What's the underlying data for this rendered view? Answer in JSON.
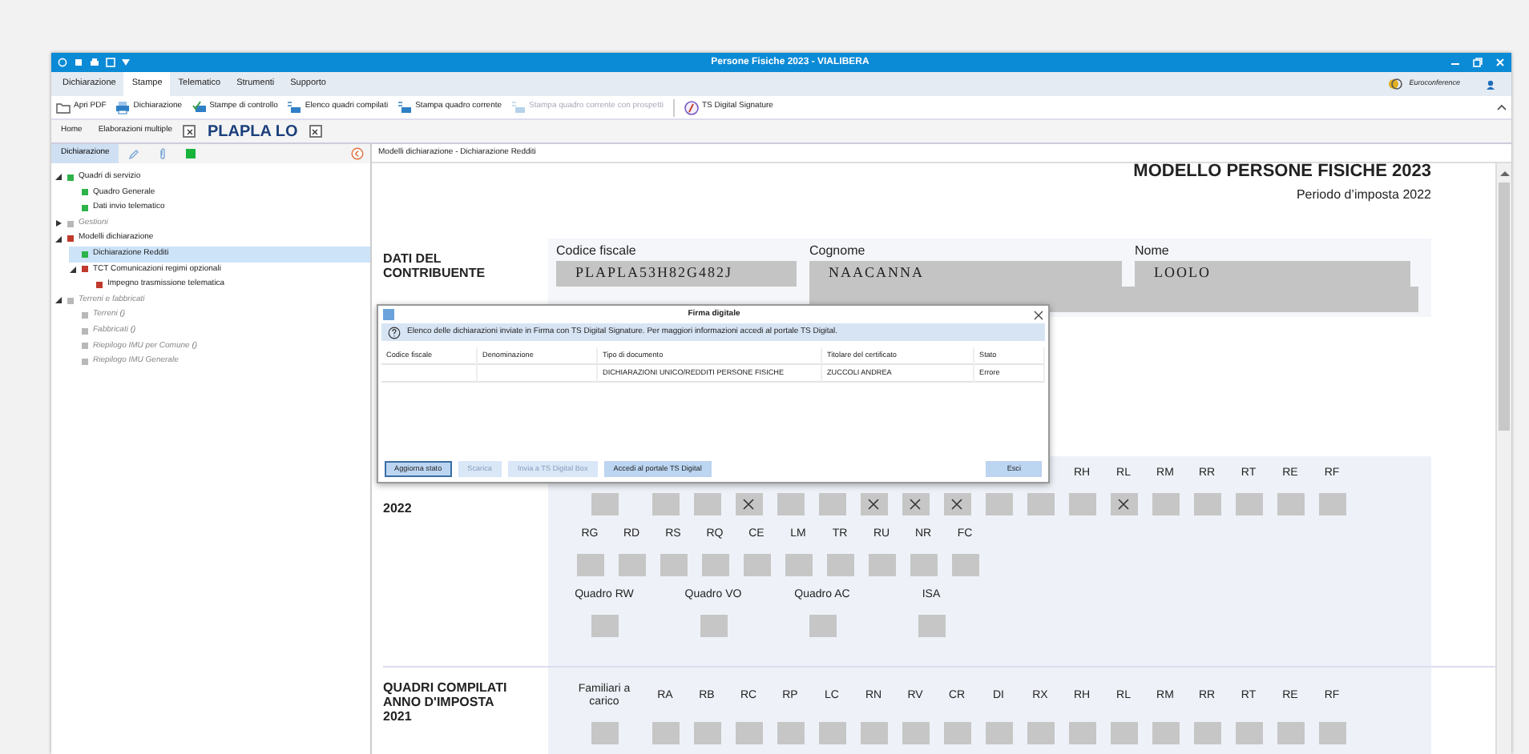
{
  "window": {
    "title": "Persone Fisiche 2023 - VIALIBERA"
  },
  "menu": [
    {
      "label": "Dichiarazione",
      "selected": false
    },
    {
      "label": "Stampe",
      "selected": true
    },
    {
      "label": "Telematico",
      "selected": false
    },
    {
      "label": "Strumenti",
      "selected": false
    },
    {
      "label": "Supporto",
      "selected": false
    }
  ],
  "brand": {
    "name": "Euroconference"
  },
  "toolbar": [
    {
      "kind": "folder",
      "label": "Apri PDF",
      "disabled": false
    },
    {
      "kind": "printer",
      "label": "Dichiarazione",
      "disabled": false
    },
    {
      "kind": "check",
      "label": "Stampe di controllo",
      "disabled": false
    },
    {
      "kind": "list",
      "label": "Elenco quadri compilati",
      "disabled": false
    },
    {
      "kind": "list",
      "label": "Stampa quadro corrente",
      "disabled": false
    },
    {
      "kind": "list",
      "label": "Stampa quadro corrente con prospetti",
      "disabled": true
    },
    {
      "kind": "signature",
      "label": "TS Digital Signature",
      "disabled": false
    }
  ],
  "tabs": [
    {
      "label": "Home",
      "closable": false,
      "selected": false
    },
    {
      "label": "Elaborazioni multiple",
      "closable": true,
      "selected": false
    },
    {
      "label": "PLAPLA LO",
      "closable": true,
      "selected": true
    }
  ],
  "panel_tabs": [
    {
      "kind": "text",
      "label": "Dichiarazione",
      "selected": true
    },
    {
      "kind": "pencil",
      "selected": false
    },
    {
      "kind": "clip",
      "selected": false
    },
    {
      "kind": "status",
      "selected": false
    }
  ],
  "breadcrumb": "Modelli dichiarazione - Dichiarazione Redditi",
  "tree": [
    {
      "label": "Quadri di servizio",
      "color": "#2db34a",
      "empty": false,
      "expanded": true,
      "children": [
        {
          "label": "Quadro Generale",
          "color": "#2db34a",
          "empty": false,
          "selected": false
        },
        {
          "label": "Dati invio telematico",
          "color": "#2db34a",
          "empty": false,
          "selected": false
        }
      ],
      "selected": false
    },
    {
      "label": "Gestioni",
      "color": "#b8b8b8",
      "empty": true,
      "expanded": false,
      "selected": false
    },
    {
      "label": "Modelli dichiarazione",
      "color": "#c0392b",
      "empty": false,
      "expanded": true,
      "selected": false,
      "children": [
        {
          "label": "Dichiarazione Redditi",
          "color": "#2db34a",
          "empty": false,
          "selected": true
        },
        {
          "label": "TCT Comunicazioni regimi opzionali",
          "color": "#c0392b",
          "empty": false,
          "expanded": true,
          "selected": false,
          "children": [
            {
              "label": "Impegno trasmissione telematica",
              "color": "#c0392b",
              "empty": false,
              "selected": false
            }
          ]
        }
      ]
    },
    {
      "label": "Terreni e fabbricati",
      "color": "#b8b8b8",
      "empty": true,
      "expanded": true,
      "selected": false,
      "children": [
        {
          "label": "Terreni ()",
          "color": "#b8b8b8",
          "empty": true,
          "selected": false
        },
        {
          "label": "Fabbricati ()",
          "color": "#b8b8b8",
          "empty": true,
          "selected": false
        },
        {
          "label": "Riepilogo IMU per Comune ()",
          "color": "#b8b8b8",
          "empty": true,
          "selected": false
        },
        {
          "label": "Riepilogo IMU Generale",
          "color": "#b8b8b8",
          "empty": true,
          "selected": false
        }
      ]
    }
  ],
  "document": {
    "title": "MODELLO PERSONE FISICHE 2023",
    "subtitle": "Periodo d’imposta 2022",
    "taxpayer": {
      "heading": "DATI DEL CONTRIBUENTE",
      "fields": [
        {
          "label": "Codice fiscale",
          "value": "PLAPLA53H82G482J"
        },
        {
          "label": "Cognome",
          "value": "NAACANNA"
        },
        {
          "label": "Nome",
          "value": "LOOLO"
        }
      ]
    },
    "sections": [
      {
        "heading_lines": [
          "2022"
        ],
        "boxes": [
          {
            "checked": false
          },
          {
            "checked": false
          },
          {
            "checked": false
          },
          {
            "checked": true
          },
          {
            "checked": false
          },
          {
            "checked": false
          },
          {
            "checked": true
          },
          {
            "checked": true
          },
          {
            "checked": true
          },
          {
            "checked": false
          },
          {
            "checked": false
          },
          {
            "label": "RH",
            "checked": false
          },
          {
            "label": "RL",
            "checked": true
          },
          {
            "label": "RM",
            "checked": false
          },
          {
            "label": "RR",
            "checked": false
          },
          {
            "label": "RT",
            "checked": false
          },
          {
            "label": "RE",
            "checked": false
          },
          {
            "label": "RF",
            "checked": false
          }
        ],
        "row2": [
          {
            "label": "RG",
            "checked": false
          },
          {
            "label": "RD",
            "checked": false
          },
          {
            "label": "RS",
            "checked": false
          },
          {
            "label": "RQ",
            "checked": false
          },
          {
            "label": "CE",
            "checked": false
          },
          {
            "label": "LM",
            "checked": false
          },
          {
            "label": "TR",
            "checked": false
          },
          {
            "label": "RU",
            "checked": false
          },
          {
            "label": "NR",
            "checked": false
          },
          {
            "label": "FC",
            "checked": false
          }
        ],
        "row3": [
          {
            "label": "Quadro RW",
            "checked": false
          },
          {
            "label": "Quadro VO",
            "checked": false
          },
          {
            "label": "Quadro AC",
            "checked": false
          },
          {
            "label": "ISA",
            "checked": false
          }
        ]
      },
      {
        "heading_lines": [
          "QUADRI COMPILATI",
          "ANNO D'IMPOSTA",
          "2021"
        ],
        "boxes": [
          {
            "label": "Familiari a carico",
            "checked": false
          },
          {
            "label": "RA",
            "checked": false
          },
          {
            "label": "RB",
            "checked": false
          },
          {
            "label": "RC",
            "checked": false
          },
          {
            "label": "RP",
            "checked": false
          },
          {
            "label": "LC",
            "checked": false
          },
          {
            "label": "RN",
            "checked": false
          },
          {
            "label": "RV",
            "checked": false
          },
          {
            "label": "CR",
            "checked": false
          },
          {
            "label": "DI",
            "checked": false
          },
          {
            "label": "RX",
            "checked": false
          },
          {
            "label": "RH",
            "checked": false
          },
          {
            "label": "RL",
            "checked": false
          },
          {
            "label": "RM",
            "checked": false
          },
          {
            "label": "RR",
            "checked": false
          },
          {
            "label": "RT",
            "checked": false
          },
          {
            "label": "RE",
            "checked": false
          },
          {
            "label": "RF",
            "checked": false
          }
        ]
      }
    ]
  },
  "dialog": {
    "title": "Firma digitale",
    "info": "Elenco delle dichiarazioni inviate in Firma con TS Digital Signature. Per maggiori informazioni accedi al portale TS Digital.",
    "columns": [
      "Codice fiscale",
      "Denominazione",
      "Tipo di documento",
      "Titolare del certificato",
      "Stato"
    ],
    "rows": [
      [
        null,
        null,
        "DICHIARAZIONI UNICO/REDDITI PERSONE FISICHE",
        "ZUCCOLI ANDREA",
        "Errore"
      ]
    ],
    "buttons": [
      {
        "kind": "action",
        "label": "Aggiorna stato",
        "disabled": false,
        "default": true
      },
      {
        "kind": "action",
        "label": "Scarica",
        "disabled": true,
        "default": false
      },
      {
        "kind": "action",
        "label": "Invia a TS Digital Box",
        "disabled": true,
        "default": false
      },
      {
        "kind": "action",
        "label": "Accedi al portale TS Digital",
        "disabled": false,
        "default": false
      },
      {
        "kind": "close",
        "label": "Esci",
        "disabled": false,
        "default": false
      }
    ]
  }
}
